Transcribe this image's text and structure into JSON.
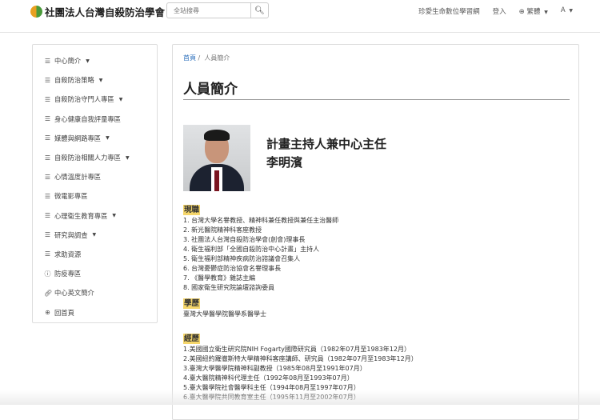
{
  "header": {
    "logo_text": "社團法人台灣自殺防治學會",
    "search_placeholder": "全站搜尋",
    "nav": [
      "珍愛生命數位學習網",
      "登入",
      "繁體",
      "A"
    ]
  },
  "sidebar": {
    "items": [
      {
        "label": "中心簡介",
        "icon": "menu",
        "caret": true
      },
      {
        "label": "自殺防治策略",
        "icon": "menu",
        "caret": true
      },
      {
        "label": "自殺防治守門人專區",
        "icon": "menu",
        "caret": true
      },
      {
        "label": "身心健康自我評量專區",
        "icon": "menu",
        "caret": false
      },
      {
        "label": "媒體與網路專區",
        "icon": "menu",
        "caret": true
      },
      {
        "label": "自殺防治相關人力專區",
        "icon": "menu",
        "caret": true
      },
      {
        "label": "心情溫度計專區",
        "icon": "menu",
        "caret": false
      },
      {
        "label": "微電影專區",
        "icon": "menu",
        "caret": false
      },
      {
        "label": "心理衛生教育專區",
        "icon": "menu",
        "caret": true
      },
      {
        "label": "研究與調查",
        "icon": "menu",
        "caret": true
      },
      {
        "label": "求助資源",
        "icon": "menu",
        "caret": false
      },
      {
        "label": "防疫專區",
        "icon": "info",
        "caret": false
      },
      {
        "label": "中心英文簡介",
        "icon": "link",
        "caret": false
      },
      {
        "label": "回首頁",
        "icon": "globe",
        "caret": false
      }
    ]
  },
  "breadcrumb": {
    "home": "首頁",
    "current": "人員簡介"
  },
  "page_title": "人員簡介",
  "profile": {
    "role": "計畫主持人兼中心主任",
    "name": "李明濱"
  },
  "sections": [
    {
      "heading": "現職",
      "items": [
        "1. 台灣大學名譽教授、精神科兼任教授與兼任主治醫師",
        "2. 新光醫院精神科客座教授",
        "3. 社團法人台灣自殺防治學會(創會)理事長",
        "4. 衛生福利部「全國自殺防治中心計畫」主持人",
        "5. 衛生福利部精神疾病防治諮議會召集人",
        "6. 台灣憂鬱症防治協會名譽理事長",
        "7. 《醫學教育》雜誌主編",
        "8. 國家衛生研究院論壇諮詢委員"
      ]
    },
    {
      "heading": "學歷",
      "items": [
        "臺灣大學醫學院醫學系醫學士"
      ]
    },
    {
      "heading": "經歷",
      "items": [
        "1.美國國立衛生研究院NIH Fogarty國際研究員（1982年07月至1983年12月）",
        "2.美國紐約羅徹斯特大學精神科客座講師、研究員（1982年07月至1983年12月）",
        "3.臺灣大學醫學院精神科副教授（1985年08月至1991年07月）",
        "4.臺大醫院精神科代理主任（1992年08月至1993年07月）",
        "5.臺大醫學院社會醫學科主任（1994年08月至1997年07月）",
        "6.臺大醫學院共同教育室主任（1995年11月至2002年07月）"
      ]
    }
  ]
}
